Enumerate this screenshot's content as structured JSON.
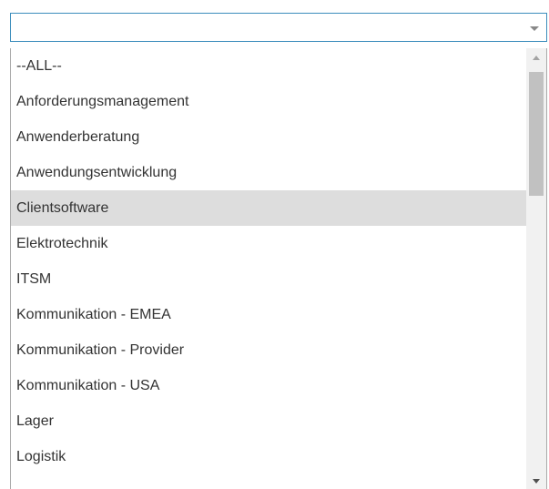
{
  "select": {
    "value": ""
  },
  "options": [
    {
      "label": "--ALL--"
    },
    {
      "label": "Anforderungsmanagement"
    },
    {
      "label": "Anwenderberatung"
    },
    {
      "label": "Anwendungsentwicklung"
    },
    {
      "label": "Clientsoftware",
      "selected": true
    },
    {
      "label": "Elektrotechnik"
    },
    {
      "label": "ITSM"
    },
    {
      "label": "Kommunikation - EMEA"
    },
    {
      "label": "Kommunikation - Provider"
    },
    {
      "label": "Kommunikation - USA"
    },
    {
      "label": "Lager"
    },
    {
      "label": "Logistik"
    }
  ],
  "scrollbar": {
    "up_icon": "chevron-up-icon",
    "down_icon": "chevron-down-icon"
  },
  "colors": {
    "focus_border": "#3c8dbc",
    "highlight": "#dddddd",
    "text": "#333333"
  }
}
